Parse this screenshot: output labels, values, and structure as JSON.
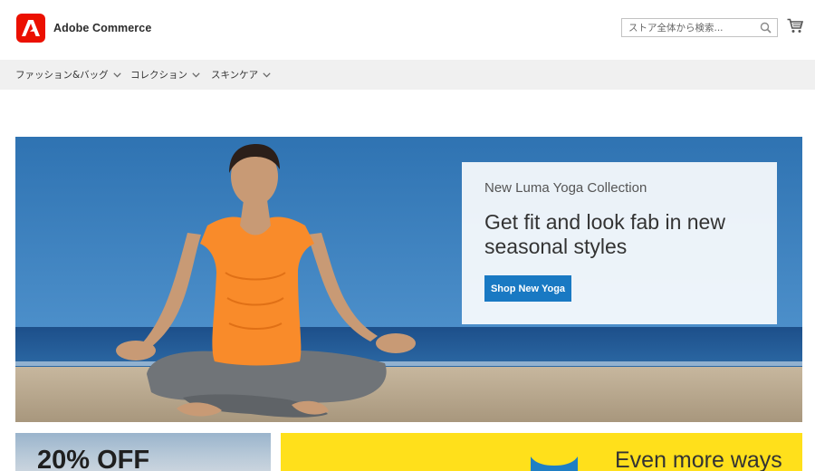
{
  "brand": {
    "name": "Adobe Commerce",
    "color": "#eb1000"
  },
  "search": {
    "placeholder": "ストア全体から検索...",
    "icon": "search-icon"
  },
  "cart": {
    "icon": "cart-icon"
  },
  "nav": {
    "items": [
      {
        "label": "ファッション&バッグ"
      },
      {
        "label": "コレクション"
      },
      {
        "label": "スキンケア"
      }
    ]
  },
  "hero": {
    "kicker": "New Luma Yoga Collection",
    "headline": "Get fit and look fab in new seasonal styles",
    "button_label": "Shop New Yoga",
    "accent": "#1979c3"
  },
  "promos": {
    "left_text": "20% OFF",
    "right_text": "Even more ways"
  }
}
